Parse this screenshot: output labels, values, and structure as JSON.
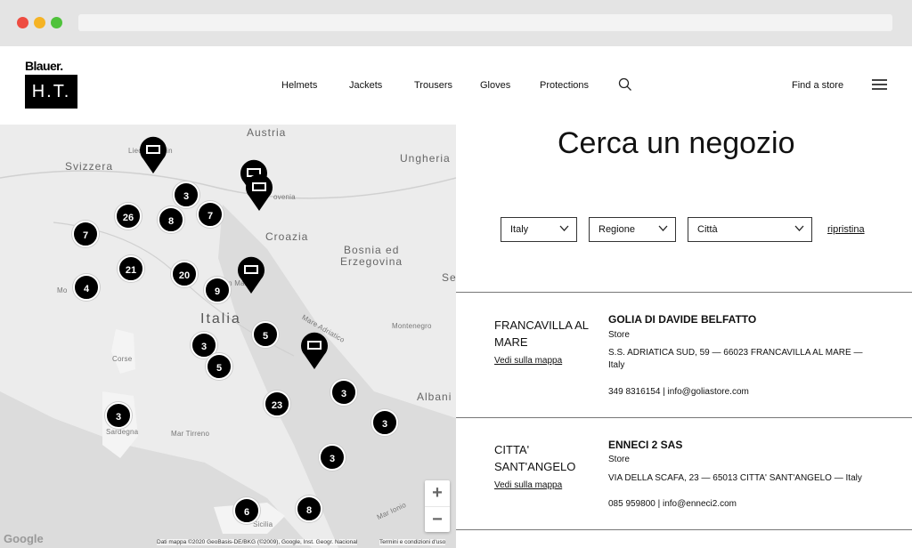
{
  "header": {
    "logo_top": "Blauer.",
    "logo_box": "H.T.",
    "nav": [
      "Helmets",
      "Jackets",
      "Trousers",
      "Gloves",
      "Protections"
    ],
    "find_store": "Find a store",
    "icons": [
      "search-icon",
      "menu-icon",
      "chevron-down-icon",
      "map-pin-icon"
    ]
  },
  "map": {
    "labels": {
      "austria": "Austria",
      "svizzera": "Svizzera",
      "ungheria": "Ungheria",
      "liechtenstein": "Liechtenstein",
      "slovenia": "ovenia",
      "croazia": "Croazia",
      "bosnia": "Bosnia ed",
      "erzegovina": "Erzegovina",
      "serbia": "Se",
      "italia": "Italia",
      "montenegro": "Montenegro",
      "albania": "Albani",
      "corse": "Corse",
      "sardegna": "Sardegna",
      "sicilia": "Sicilia",
      "mar_tirreno": "Mar Tirreno",
      "mar_adriatico": "Mare Adriatico",
      "mar_ionio": "Mar Ionio",
      "monaco": "Mo",
      "san_marino": "San Marino"
    },
    "clusters": [
      "3",
      "26",
      "8",
      "7",
      "7",
      "21",
      "20",
      "9",
      "4",
      "3",
      "5",
      "5",
      "3",
      "23",
      "3",
      "3",
      "3",
      "6",
      "8"
    ],
    "zoom_in": "+",
    "zoom_out": "−",
    "attribution": "Dati mappa ©2020 GeoBasis-DE/BKG (©2009), Google, Inst. Geogr. Nacional",
    "terms": "Termini e condizioni d'uso",
    "google": "Google"
  },
  "panel": {
    "title": "Cerca un negozio",
    "filters": {
      "country": "Italy",
      "region": "Regione",
      "city": "Città"
    },
    "reset": "ripristina"
  },
  "stores": [
    {
      "city": "FRANCAVILLA AL MARE",
      "link": "Vedi sulla mappa",
      "name": "GOLIA DI DAVIDE BELFATTO",
      "type": "Store",
      "address": "S.S. ADRIATICA SUD, 59 — 66023 FRANCAVILLA AL MARE — Italy",
      "contact": "349 8316154  | info@goliastore.com"
    },
    {
      "city": "CITTA' SANT'ANGELO",
      "link": "Vedi sulla mappa",
      "name": "ENNECI 2 SAS",
      "type": "Store",
      "address": "VIA DELLA SCAFA, 23 — 65013 CITTA' SANT'ANGELO — Italy",
      "contact": "085 959800  | info@enneci2.com"
    }
  ]
}
